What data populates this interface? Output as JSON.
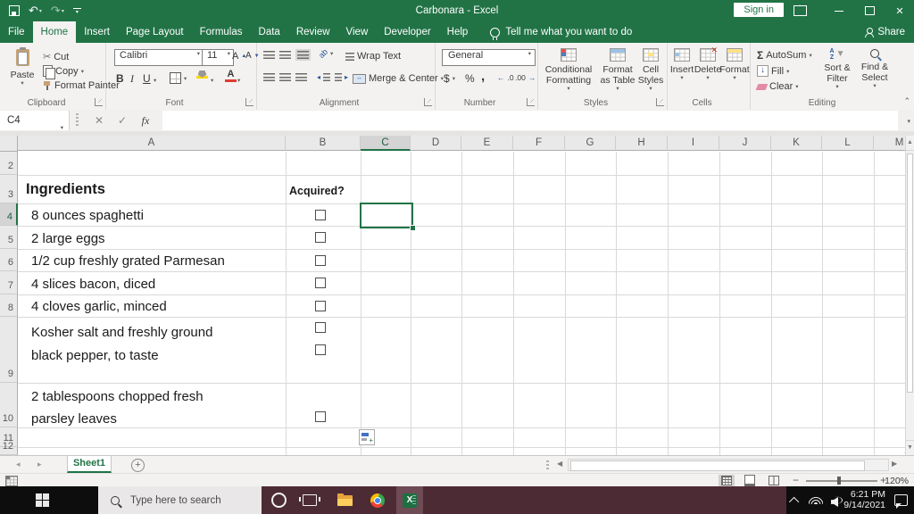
{
  "titlebar": {
    "title": "Carbonara  -  Excel",
    "sign_in": "Sign in"
  },
  "menu": {
    "tabs": [
      "File",
      "Home",
      "Insert",
      "Page Layout",
      "Formulas",
      "Data",
      "Review",
      "View",
      "Developer",
      "Help"
    ],
    "active": "Home",
    "tell_me": "Tell me what you want to do",
    "share": "Share"
  },
  "ribbon": {
    "clipboard": {
      "label": "Clipboard",
      "paste": "Paste",
      "cut": "Cut",
      "copy": "Copy",
      "format_painter": "Format Painter"
    },
    "font": {
      "label": "Font",
      "name": "Calibri",
      "size": "11",
      "bold": "B",
      "italic": "I",
      "underline": "U"
    },
    "alignment": {
      "label": "Alignment",
      "wrap": "Wrap Text",
      "merge": "Merge & Center"
    },
    "number": {
      "label": "Number",
      "format": "General",
      "currency": "$",
      "percent": "%",
      "comma": ","
    },
    "styles": {
      "label": "Styles",
      "conditional": "Conditional Formatting",
      "format_table": "Format as Table",
      "cell_styles": "Cell Styles"
    },
    "cells": {
      "label": "Cells",
      "insert": "Insert",
      "delete": "Delete",
      "format": "Format"
    },
    "editing": {
      "label": "Editing",
      "sigma": "Σ",
      "autosum": "AutoSum",
      "fill": "Fill",
      "clear": "Clear",
      "sort": "Sort & Filter",
      "find": "Find & Select"
    }
  },
  "formula_bar": {
    "name_box": "C4",
    "fx": "fx",
    "value": ""
  },
  "sheet": {
    "columns": [
      "A",
      "B",
      "C",
      "D",
      "E",
      "F",
      "G",
      "H",
      "I",
      "J",
      "K",
      "L",
      "M"
    ],
    "selected_column": "C",
    "rows": [
      "2",
      "3",
      "4",
      "5",
      "6",
      "7",
      "8",
      "9",
      "10",
      "11",
      "12"
    ],
    "selected_row": "4",
    "selected_cell": "C4",
    "title_cell": "Ingredients",
    "acquired_header": "Acquired?",
    "items": [
      {
        "row": "4",
        "text": "8 ounces spaghetti",
        "checkboxes": 1
      },
      {
        "row": "5",
        "text": "2 large eggs",
        "checkboxes": 1
      },
      {
        "row": "6",
        "text": "1/2 cup freshly grated Parmesan",
        "checkboxes": 1
      },
      {
        "row": "7",
        "text": "4 slices bacon, diced",
        "checkboxes": 1
      },
      {
        "row": "8",
        "text": "4 cloves garlic, minced",
        "checkboxes": 1
      },
      {
        "row": "9",
        "text": "Kosher salt and freshly ground\nblack pepper, to taste",
        "checkboxes": 2
      },
      {
        "row": "10",
        "text": "2 tablespoons chopped fresh\nparsley leaves",
        "checkboxes": 1
      }
    ],
    "tab": "Sheet1"
  },
  "status_bar": {
    "zoom_level": "120%"
  },
  "taskbar": {
    "search_placeholder": "Type here to search",
    "time": "6:21 PM",
    "date": "9/14/2021"
  }
}
